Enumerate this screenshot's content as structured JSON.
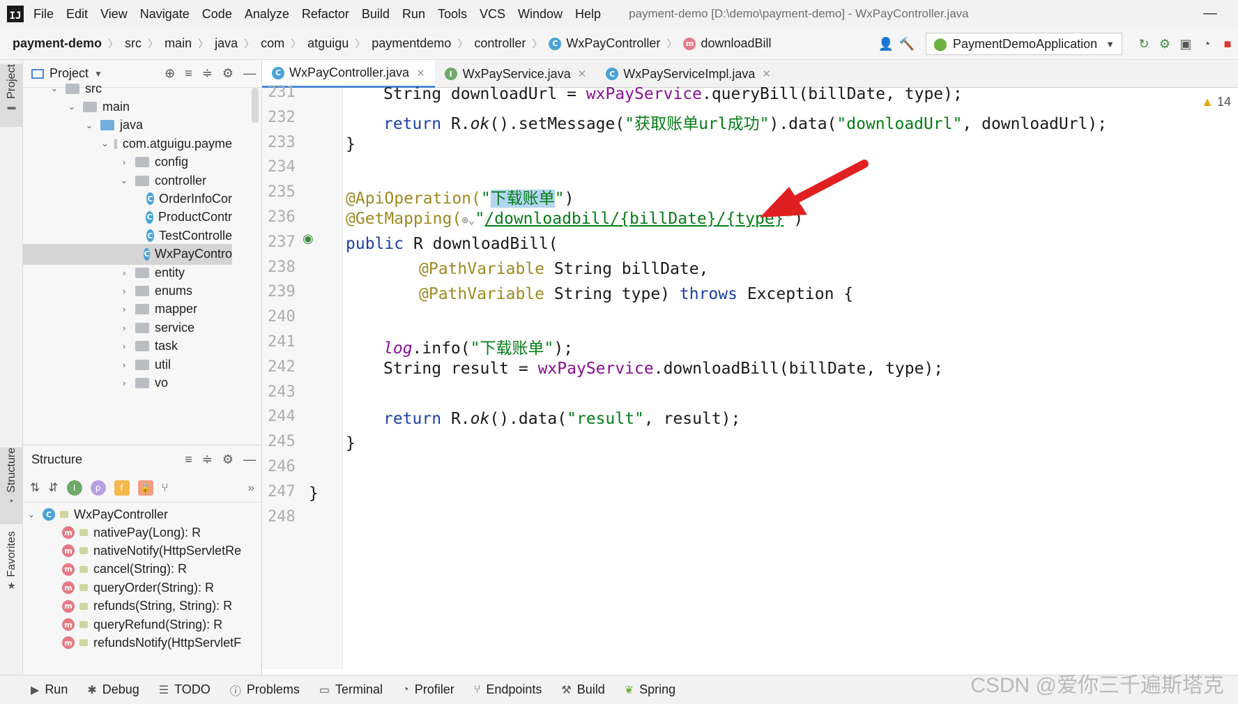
{
  "menu": {
    "items": [
      "File",
      "Edit",
      "View",
      "Navigate",
      "Code",
      "Analyze",
      "Refactor",
      "Build",
      "Run",
      "Tools",
      "VCS",
      "Window",
      "Help"
    ],
    "window_title": "payment-demo [D:\\demo\\payment-demo] - WxPayController.java",
    "logo": "IJ"
  },
  "breadcrumbs": [
    "payment-demo",
    "src",
    "main",
    "java",
    "com",
    "atguigu",
    "paymentdemo",
    "controller",
    "WxPayController",
    "downloadBill"
  ],
  "run_config": "PaymentDemoApplication",
  "left_strip": {
    "project": "Project",
    "structure": "Structure",
    "favorites": "Favorites"
  },
  "project_panel": {
    "title": "Project",
    "tree": [
      {
        "label": "src",
        "chev": "⌄"
      },
      {
        "label": "main",
        "chev": "⌄"
      },
      {
        "label": "java",
        "chev": "⌄"
      },
      {
        "label": "com.atguigu.payme",
        "chev": "⌄"
      },
      {
        "label": "config",
        "chev": "›"
      },
      {
        "label": "controller",
        "chev": "⌄"
      },
      {
        "label": "OrderInfoCor"
      },
      {
        "label": "ProductContr"
      },
      {
        "label": "TestControlle"
      },
      {
        "label": "WxPayContro"
      },
      {
        "label": "entity",
        "chev": "›"
      },
      {
        "label": "enums",
        "chev": "›"
      },
      {
        "label": "mapper",
        "chev": "›"
      },
      {
        "label": "service",
        "chev": "›"
      },
      {
        "label": "task",
        "chev": "›"
      },
      {
        "label": "util",
        "chev": "›"
      },
      {
        "label": "vo",
        "chev": "›"
      }
    ]
  },
  "structure_panel": {
    "title": "Structure",
    "badges": {
      "info": "I",
      "p": "p",
      "f": "f"
    },
    "root": "WxPayController",
    "members": [
      "nativePay(Long): R",
      "nativeNotify(HttpServletRe",
      "cancel(String): R",
      "queryOrder(String): R",
      "refunds(String, String): R",
      "queryRefund(String): R",
      "refundsNotify(HttpServletF"
    ]
  },
  "tabs": [
    {
      "label": "WxPayController.java",
      "badge": "C",
      "active": true
    },
    {
      "label": "WxPayService.java",
      "badge": "I",
      "active": false
    },
    {
      "label": "WxPayServiceImpl.java",
      "badge": "C",
      "active": false
    }
  ],
  "editor": {
    "line_numbers": [
      "231",
      "232",
      "233",
      "234",
      "235",
      "236",
      "237",
      "238",
      "239",
      "240",
      "241",
      "242",
      "243",
      "244",
      "245",
      "246",
      "247",
      "248"
    ],
    "warning_count": "14",
    "code": {
      "l231a": "String downloadUrl = ",
      "l231b": "wxPayService",
      "l231c": ".queryBill(billDate, type);",
      "l232a": "return ",
      "l232b": "R.",
      "l232c": "ok",
      "l232d": "().setMessage(",
      "l232e": "\"获取账单url成功\"",
      "l232f": ").data(",
      "l232g": "\"downloadUrl\"",
      "l232h": ", downloadUrl);",
      "l233": "}",
      "l235a": "@ApiOperation(",
      "l235b": "\"",
      "l235c": "下载账单",
      "l235d": "\"",
      "l235e": ")",
      "l236a": "@GetMapping(",
      "l236b": "\"",
      "l236c": "/downloadbill/{billDate}/{type}",
      "l236d": "\"",
      "l236e": ")",
      "l237a": "public ",
      "l237b": "R downloadBill(",
      "l238a": "@PathVariable",
      "l238b": " String billDate,",
      "l239a": "@PathVariable",
      "l239b": " String type) ",
      "l239c": "throws",
      "l239d": " Exception {",
      "l241a": "log",
      "l241b": ".info(",
      "l241c": "\"下载账单\"",
      "l241d": ");",
      "l242a": "String result = ",
      "l242b": "wxPayService",
      "l242c": ".downloadBill(billDate, type);",
      "l244a": "return ",
      "l244b": "R.",
      "l244c": "ok",
      "l244d": "().data(",
      "l244e": "\"result\"",
      "l244f": ", result);",
      "l245": "}",
      "l247": "}"
    }
  },
  "bottom_tools": [
    "Run",
    "Debug",
    "TODO",
    "Problems",
    "Terminal",
    "Profiler",
    "Endpoints",
    "Build",
    "Spring"
  ],
  "watermark": "CSDN @爱你三千遍斯塔克",
  "colors": {
    "accent": "#4a89dc",
    "arrow": "#e02020"
  }
}
